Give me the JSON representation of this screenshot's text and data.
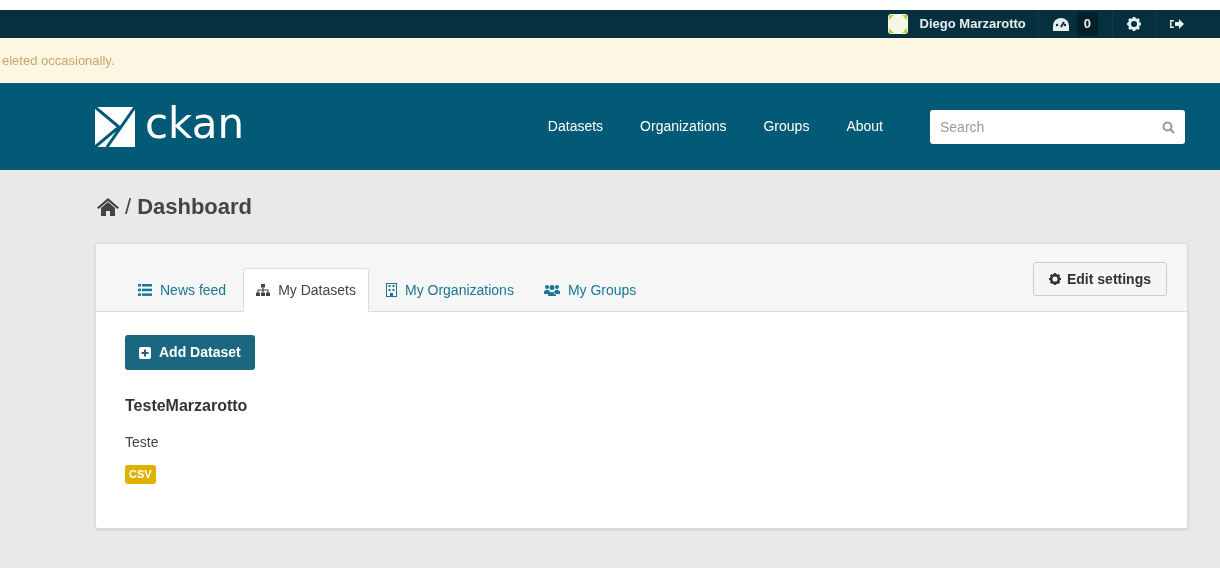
{
  "account": {
    "name": "Diego Marzarotto",
    "dashboard_count": "0"
  },
  "notice": {
    "text": "eleted occasionally."
  },
  "masthead": {
    "logo": "ckan",
    "nav": [
      "Datasets",
      "Organizations",
      "Groups",
      "About"
    ],
    "search": {
      "placeholder": "Search"
    }
  },
  "breadcrumb": {
    "separator": "/",
    "title": "Dashboard"
  },
  "tabs": [
    {
      "label": "News feed",
      "kind": "list",
      "selected": false
    },
    {
      "label": "My Datasets",
      "kind": "hierarchy",
      "selected": true
    },
    {
      "label": "My Organizations",
      "kind": "building",
      "selected": false
    },
    {
      "label": "My Groups",
      "kind": "people",
      "selected": false
    }
  ],
  "edit_button": "Edit settings",
  "add_button": "Add Dataset",
  "datasets": [
    {
      "title": "TesteMarzarotto",
      "notes": "Teste",
      "formats": [
        "CSV"
      ]
    }
  ]
}
